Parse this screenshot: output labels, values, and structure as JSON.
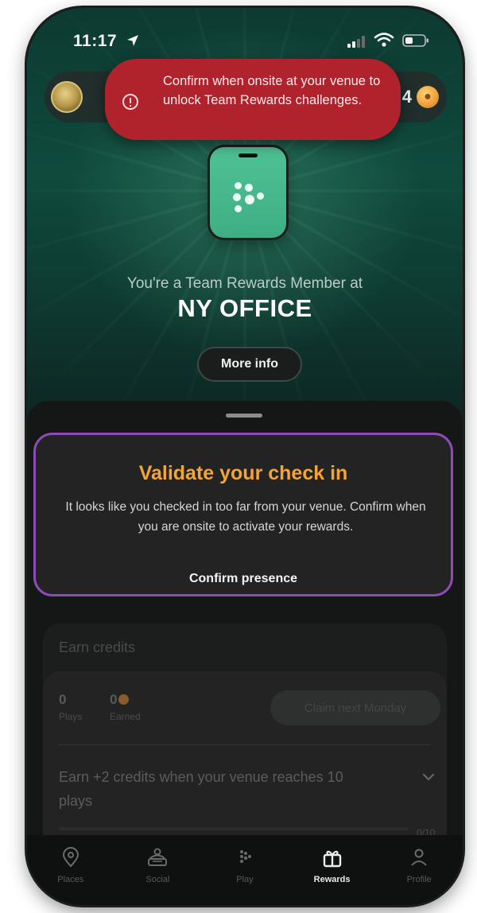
{
  "status_bar": {
    "time": "11:17"
  },
  "toast": {
    "message": "Confirm when onsite at your venue to unlock Team Rewards challenges."
  },
  "header": {
    "credits_suffix": "4"
  },
  "hero": {
    "subtitle": "You're a Team Rewards Member at",
    "venue_name": "NY OFFICE",
    "more_info_label": "More info"
  },
  "validate_card": {
    "title": "Validate your check in",
    "body": "It looks like you checked in too far from your venue. Confirm when you are onsite to activate your rewards.",
    "action_label": "Confirm presence"
  },
  "earn_credits": {
    "title": "Earn credits",
    "plays_value": "0",
    "plays_label": "Plays",
    "earned_value": "0",
    "earned_label": "Earned",
    "claim_label": "Claim next Monday",
    "goal_text": "Earn +2 credits when your venue reaches 10 plays",
    "goal_progress": "0/10",
    "goal_progress_fraction": 0
  },
  "tabs": [
    {
      "label": "Places",
      "icon": "map-pin-icon",
      "active": false
    },
    {
      "label": "Social",
      "icon": "social-icon",
      "active": false
    },
    {
      "label": "Play",
      "icon": "play-dots-icon",
      "active": false
    },
    {
      "label": "Rewards",
      "icon": "gift-icon",
      "active": true
    },
    {
      "label": "Profile",
      "icon": "person-icon",
      "active": false
    }
  ],
  "colors": {
    "accent_orange": "#f3a434",
    "toast_red": "#b0222c",
    "highlight_purple": "#8e4bb8",
    "device_green": "#4fc296"
  }
}
